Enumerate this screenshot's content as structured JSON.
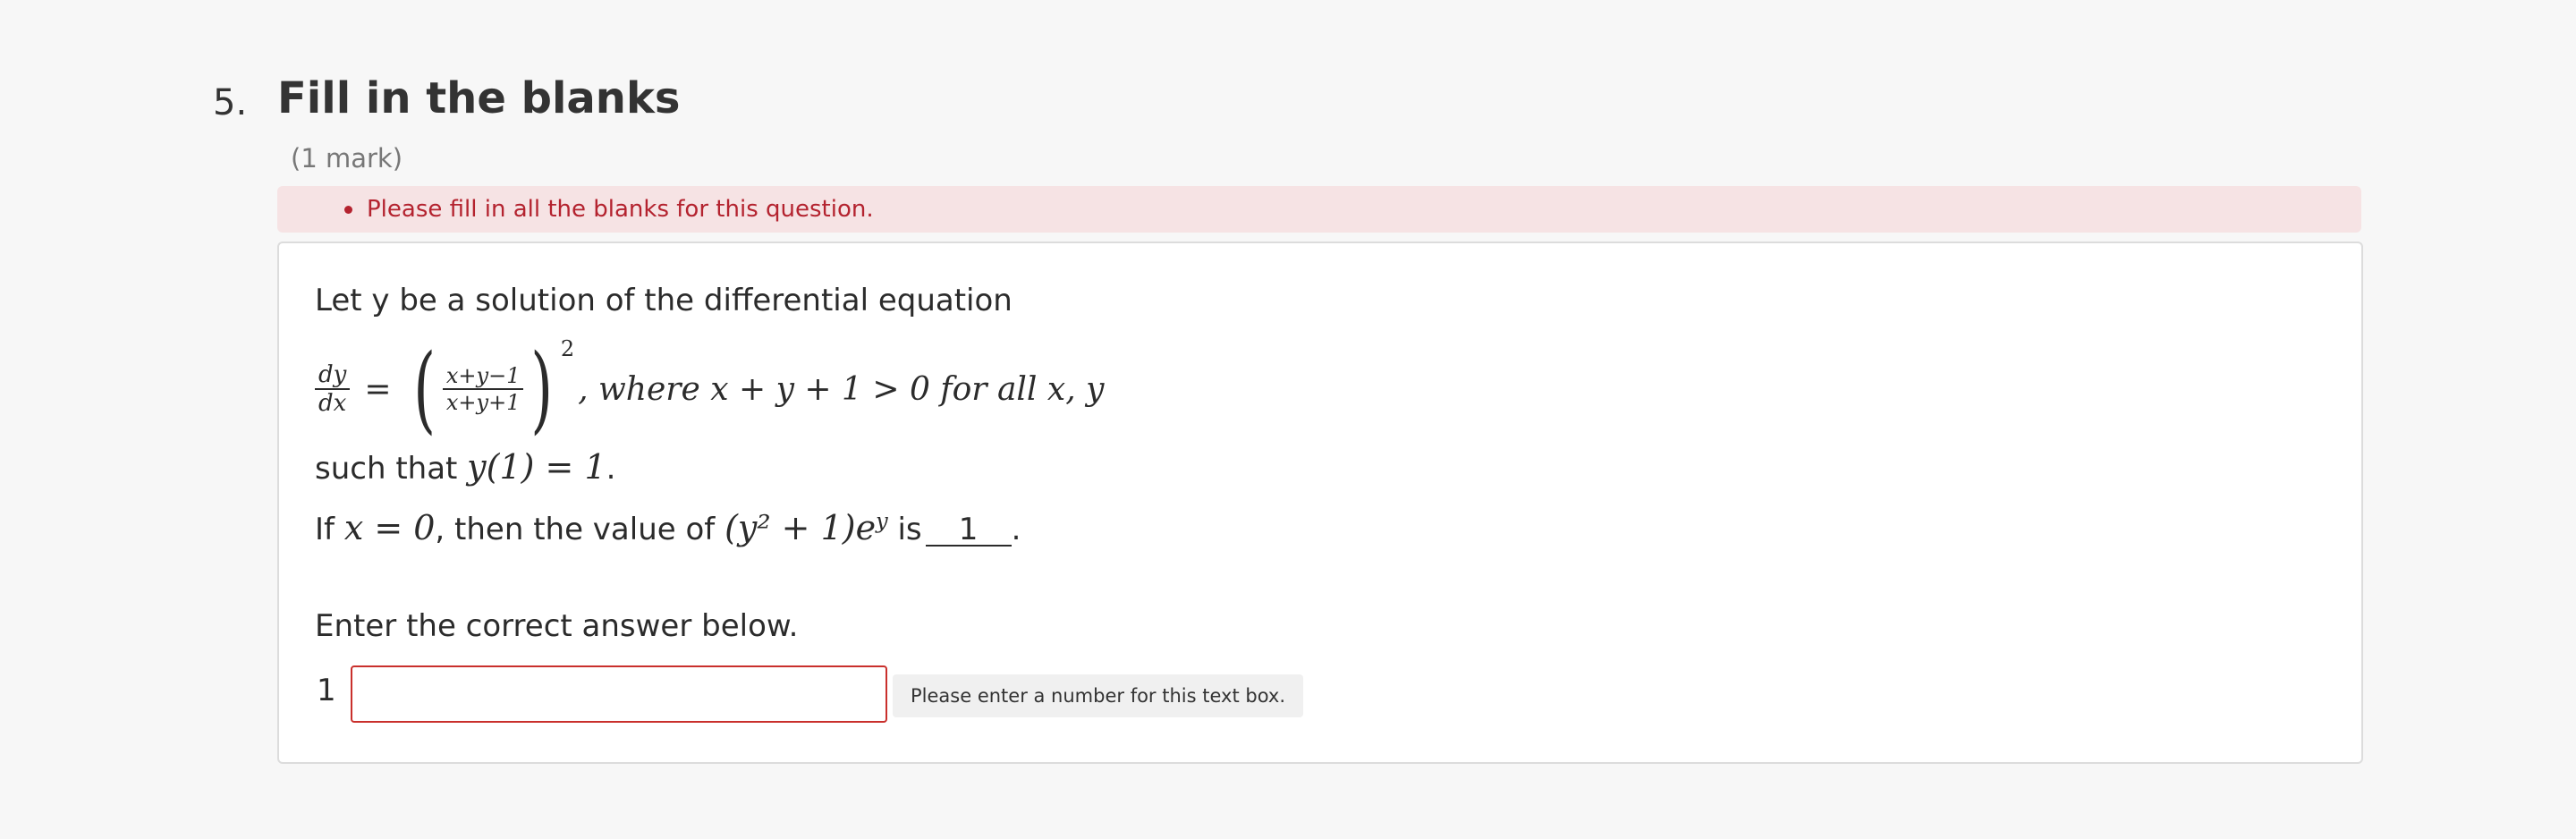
{
  "question": {
    "number": "5.",
    "title": "Fill in the blanks",
    "marks": "(1 mark)"
  },
  "error": {
    "message": "Please fill in all the blanks for this question."
  },
  "content": {
    "intro": "Let y be a solution of the differential equation",
    "eq_dy": "dy",
    "eq_dx": "dx",
    "eq_equals": "=",
    "eq_num": "x+y−1",
    "eq_den": "x+y+1",
    "eq_exp": "2",
    "eq_tail": ", where x + y + 1 > 0 for all x, y",
    "cond_prefix": "such that ",
    "cond_math": "y(1) = 1",
    "cond_suffix": ".",
    "if_prefix": "If ",
    "if_math": "x = 0",
    "if_mid": ", then the value of ",
    "if_expr": "(y² + 1)e",
    "if_expr_sup": "y",
    "if_is": " is",
    "blank_value": "1",
    "if_end": ".",
    "prompt": "Enter the correct answer below."
  },
  "answer": {
    "index": "1",
    "value": "",
    "hint": "Please enter a number for this text box."
  },
  "colors": {
    "error_bg": "#f6e3e4",
    "error_text": "#b4232f",
    "input_border": "#c9302c"
  }
}
